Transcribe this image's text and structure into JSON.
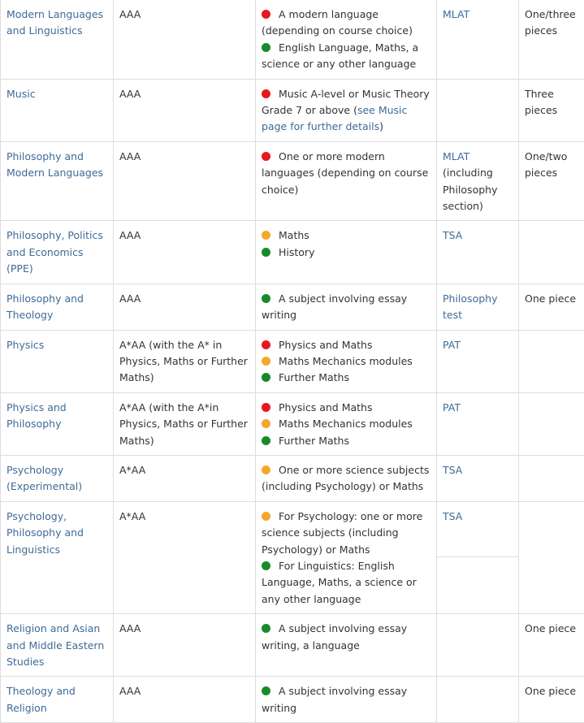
{
  "colors": {
    "red": "#e8161e",
    "amber": "#f7a62d",
    "green": "#178a2b",
    "link": "#3e6b97"
  },
  "rows": [
    {
      "course": "Modern Languages and Linguistics",
      "offer": "AAA",
      "reqs": [
        {
          "level": "red",
          "text": "A modern language (depending on course choice)"
        },
        {
          "level": "green",
          "text": "English Language, Maths, a science or any other language"
        }
      ],
      "test": "MLAT",
      "work": "One/three pieces"
    },
    {
      "course": "Music",
      "offer": "AAA",
      "reqs": [
        {
          "level": "red",
          "text": "Music A-level or Music Theory Grade 7 or above (",
          "link": "see Music page for further details",
          "after": ")"
        }
      ],
      "test": "",
      "work": "Three pieces"
    },
    {
      "course": "Philosophy and Modern Languages",
      "offer": "AAA",
      "reqs": [
        {
          "level": "red",
          "text": "One or more modern languages (depending on course choice)"
        }
      ],
      "test": "MLAT",
      "test_note": "(including Philosophy section)",
      "work": "One/two pieces"
    },
    {
      "course": "Philosophy, Politics and Economics (PPE)",
      "offer": "AAA",
      "reqs": [
        {
          "level": "amber",
          "text": "Maths"
        },
        {
          "level": "green",
          "text": "History"
        }
      ],
      "test": "TSA",
      "work": ""
    },
    {
      "course": "Philosophy and Theology",
      "offer": "AAA",
      "reqs": [
        {
          "level": "green",
          "text": "A subject involving essay writing"
        }
      ],
      "test": "Philosophy test",
      "work": "One piece"
    },
    {
      "course": "Physics",
      "offer": "A*AA (with the A* in Physics, Maths or Further Maths)",
      "reqs": [
        {
          "level": "red",
          "text": "Physics and Maths"
        },
        {
          "level": "amber",
          "text": "Maths Mechanics modules"
        },
        {
          "level": "green",
          "text": "Further Maths"
        }
      ],
      "test": "PAT",
      "work": ""
    },
    {
      "course": "Physics and Philosophy",
      "offer": "A*AA (with the A*in Physics, Maths or Further Maths)",
      "reqs": [
        {
          "level": "red",
          "text": "Physics and Maths"
        },
        {
          "level": "amber",
          "text": "Maths Mechanics modules"
        },
        {
          "level": "green",
          "text": "Further Maths"
        }
      ],
      "test": "PAT",
      "work": ""
    },
    {
      "course": "Psychology (Experimental)",
      "offer": "A*AA",
      "reqs": [
        {
          "level": "amber",
          "text": "One or more science subjects (including Psychology) or Maths"
        }
      ],
      "test": "TSA",
      "work": ""
    },
    {
      "course": "Psychology, Philosophy and Linguistics",
      "offer": "A*AA",
      "reqs": [
        {
          "level": "amber",
          "text": "For Psychology: one or more science subjects (including Psychology) or Maths"
        },
        {
          "level": "green",
          "text": "For Linguistics: English Language, Maths, a science or any other language"
        }
      ],
      "test": "TSA",
      "split": true,
      "work": ""
    },
    {
      "course": "Religion and Asian and Middle Eastern Studies",
      "offer": "AAA",
      "reqs": [
        {
          "level": "green",
          "text": "A subject involving essay writing, a language"
        }
      ],
      "test": "",
      "work": "One piece"
    },
    {
      "course": "Theology and Religion",
      "offer": "AAA",
      "reqs": [
        {
          "level": "green",
          "text": "A subject involving essay writing"
        }
      ],
      "test": "",
      "work": "One piece"
    }
  ]
}
